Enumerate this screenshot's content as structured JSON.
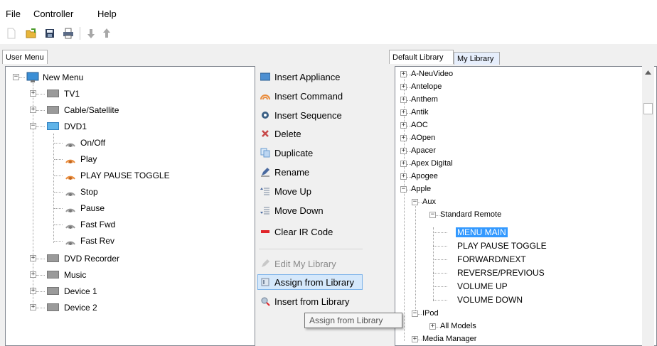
{
  "menubar": {
    "file": "File",
    "controller": "Controller",
    "help": "Help"
  },
  "toolbar": {
    "icons": [
      "new-icon",
      "open-icon",
      "save-icon",
      "print-icon",
      "move-down-icon",
      "move-up-icon"
    ]
  },
  "user_menu": {
    "tab": "User Menu",
    "root": "New Menu",
    "devices": [
      "TV1",
      "Cable/Satellite",
      "DVD1",
      "DVD Recorder",
      "Music",
      "Device 1",
      "Device 2"
    ],
    "dvd1_commands": [
      "On/Off",
      "Play",
      "PLAY PAUSE TOGGLE",
      "Stop",
      "Pause",
      "Fast Fwd",
      "Fast Rev"
    ]
  },
  "commands": {
    "insert_appliance": "Insert Appliance",
    "insert_command": "Insert Command",
    "insert_sequence": "Insert Sequence",
    "delete": "Delete",
    "duplicate": "Duplicate",
    "rename": "Rename",
    "move_up": "Move Up",
    "move_down": "Move Down",
    "clear_ir": "Clear IR Code",
    "edit_library": "Edit My Library",
    "assign_library": "Assign from Library",
    "insert_library": "Insert from Library"
  },
  "library": {
    "tab_default": "Default Library",
    "tab_my": "My Library",
    "brands": [
      "A-NeuVideo",
      "Antelope",
      "Anthem",
      "Antik",
      "AOC",
      "AOpen",
      "Apacer",
      "Apex Digital",
      "Apogee",
      "Apple"
    ],
    "aux": "Aux",
    "standard_remote": "Standard Remote",
    "remote_commands": [
      "MENU MAIN",
      "PLAY PAUSE TOGGLE",
      "FORWARD/NEXT",
      "REVERSE/PREVIOUS",
      "VOLUME UP",
      "VOLUME DOWN"
    ],
    "ipod": "IPod",
    "all_models": "All Models",
    "media_manager": "Media Manager"
  },
  "tooltip": "Assign from Library",
  "colors": {
    "selection": "#3399ff",
    "hover": "#d5e8fb",
    "clear_ir": "#e0242a"
  }
}
